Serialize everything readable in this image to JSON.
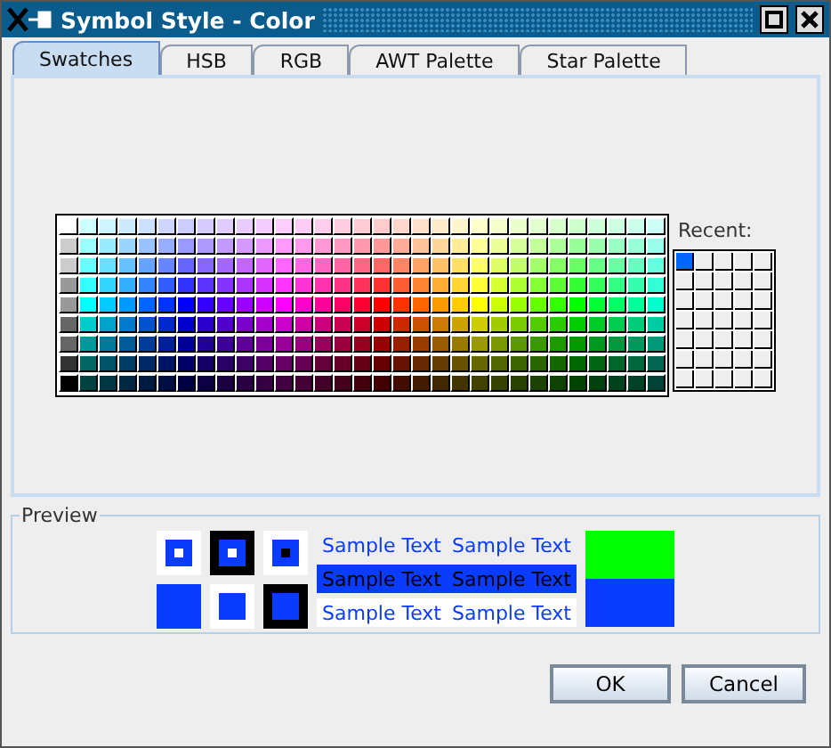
{
  "window": {
    "title": "Symbol Style - Color"
  },
  "tabs": [
    {
      "label": "Swatches",
      "selected": true
    },
    {
      "label": "HSB",
      "selected": false
    },
    {
      "label": "RGB",
      "selected": false
    },
    {
      "label": "AWT Palette",
      "selected": false
    },
    {
      "label": "Star Palette",
      "selected": false
    }
  ],
  "recent": {
    "label": "Recent:",
    "colors": [
      {
        "color": "#0066ff"
      }
    ]
  },
  "preview": {
    "title": "Preview",
    "color": "#0a3cff",
    "compare_swatches": [
      {
        "color": "#00ff00"
      },
      {
        "color": "#0a3cff"
      }
    ],
    "samples": [
      {
        "kind": "plain",
        "texts": [
          "Sample Text",
          "Sample Text"
        ]
      },
      {
        "kind": "background",
        "texts": [
          "Sample Text",
          "Sample Text"
        ]
      },
      {
        "kind": "white",
        "texts": [
          "Sample Text",
          "Sample Text"
        ]
      }
    ]
  },
  "buttons": [
    {
      "label": "OK"
    },
    {
      "label": "Cancel"
    }
  ]
}
